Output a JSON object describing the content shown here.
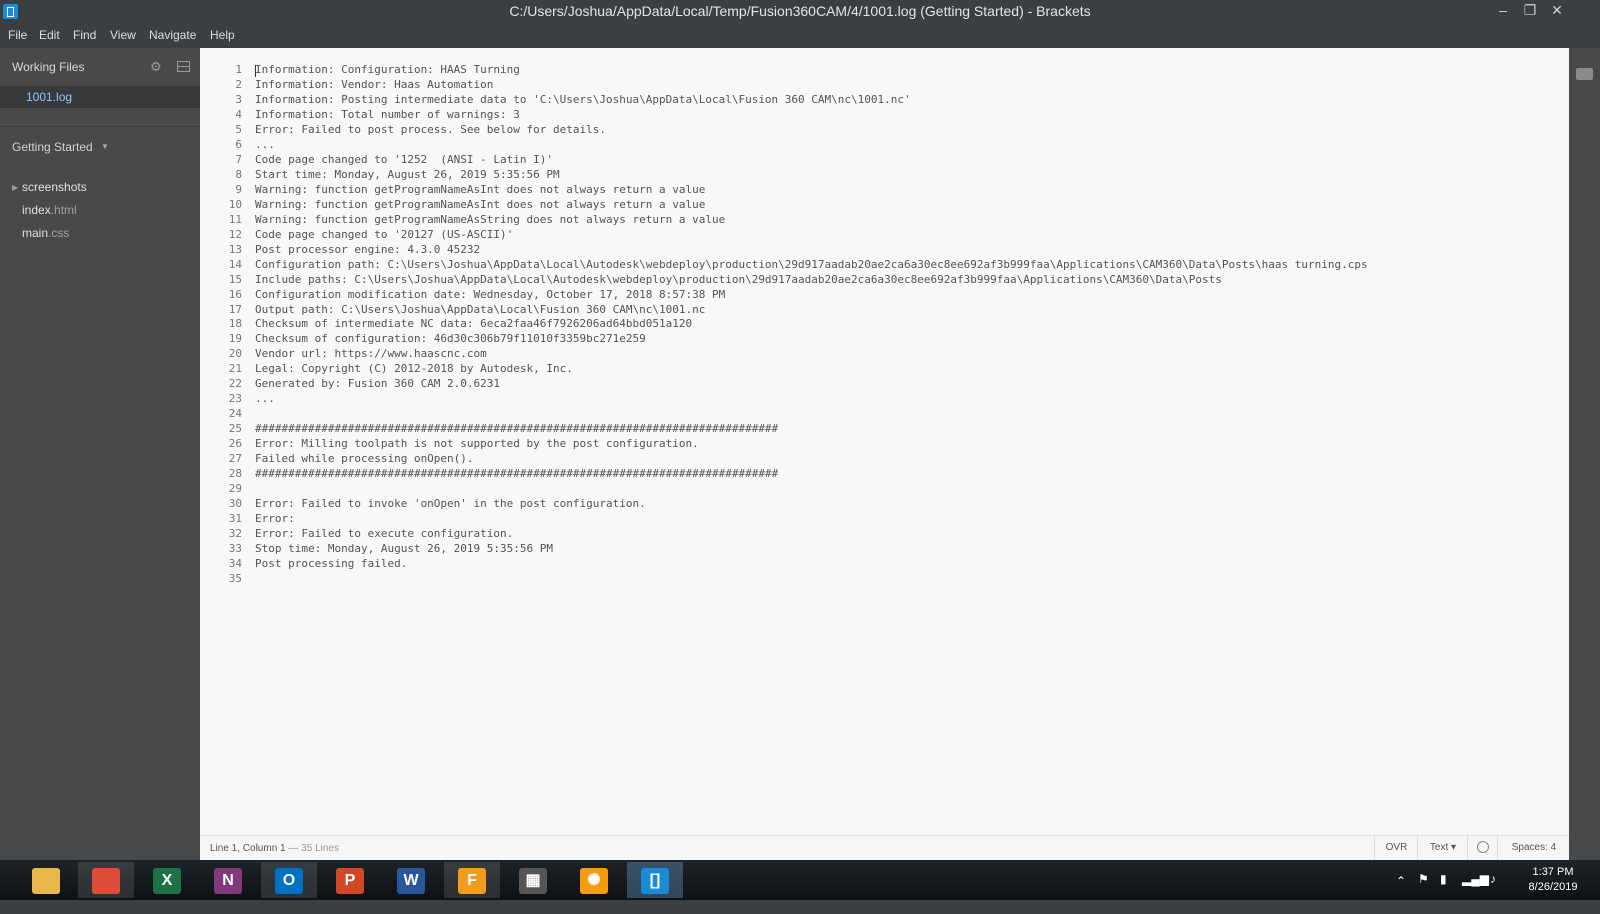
{
  "window": {
    "title": "C:/Users/Joshua/AppData/Local/Temp/Fusion360CAM/4/1001.log (Getting Started) - Brackets",
    "minimize_glyph": "–",
    "maximize_glyph": "❐",
    "close_glyph": "✕"
  },
  "menu": [
    "File",
    "Edit",
    "Find",
    "View",
    "Navigate",
    "Help"
  ],
  "sidebar": {
    "working_files_label": "Working Files",
    "working_files": [
      "1001.log"
    ],
    "project_title": "Getting Started",
    "tree": [
      {
        "name": "screenshots",
        "ext": ""
      },
      {
        "name": "index",
        "ext": ".html"
      },
      {
        "name": "main",
        "ext": ".css"
      }
    ]
  },
  "editor": {
    "lines": [
      "Information: Configuration: HAAS Turning",
      "Information: Vendor: Haas Automation",
      "Information: Posting intermediate data to 'C:\\Users\\Joshua\\AppData\\Local\\Fusion 360 CAM\\nc\\1001.nc'",
      "Information: Total number of warnings: 3",
      "Error: Failed to post process. See below for details.",
      "...",
      "Code page changed to '1252  (ANSI - Latin I)'",
      "Start time: Monday, August 26, 2019 5:35:56 PM",
      "Warning: function getProgramNameAsInt does not always return a value",
      "Warning: function getProgramNameAsInt does not always return a value",
      "Warning: function getProgramNameAsString does not always return a value",
      "Code page changed to '20127 (US-ASCII)'",
      "Post processor engine: 4.3.0 45232",
      "Configuration path: C:\\Users\\Joshua\\AppData\\Local\\Autodesk\\webdeploy\\production\\29d917aadab20ae2ca6a30ec8ee692af3b999faa\\Applications\\CAM360\\Data\\Posts\\haas turning.cps",
      "Include paths: C:\\Users\\Joshua\\AppData\\Local\\Autodesk\\webdeploy\\production\\29d917aadab20ae2ca6a30ec8ee692af3b999faa\\Applications\\CAM360\\Data\\Posts",
      "Configuration modification date: Wednesday, October 17, 2018 8:57:38 PM",
      "Output path: C:\\Users\\Joshua\\AppData\\Local\\Fusion 360 CAM\\nc\\1001.nc",
      "Checksum of intermediate NC data: 6eca2faa46f7926206ad64bbd051a120",
      "Checksum of configuration: 46d30c306b79f11010f3359bc271e259",
      "Vendor url: https://www.haascnc.com",
      "Legal: Copyright (C) 2012-2018 by Autodesk, Inc.",
      "Generated by: Fusion 360 CAM 2.0.6231",
      "...",
      "",
      "###############################################################################",
      "Error: Milling toolpath is not supported by the post configuration.",
      "Failed while processing onOpen().",
      "###############################################################################",
      "",
      "Error: Failed to invoke 'onOpen' in the post configuration.",
      "Error:",
      "Error: Failed to execute configuration.",
      "Stop time: Monday, August 26, 2019 5:35:56 PM",
      "Post processing failed.",
      ""
    ]
  },
  "status": {
    "position": "Line 1, Column 1",
    "lines_count": " — 35 Lines",
    "ovr": "OVR",
    "language": "Text ▾",
    "spaces": "Spaces: 4"
  },
  "taskbar": {
    "apps": [
      {
        "name": "file-explorer",
        "glyph": "",
        "color": "#e8b84a"
      },
      {
        "name": "chrome",
        "glyph": "",
        "color": "#dd4b39"
      },
      {
        "name": "excel",
        "glyph": "X",
        "color": "#1e7145"
      },
      {
        "name": "onenote",
        "glyph": "N",
        "color": "#80397b"
      },
      {
        "name": "outlook",
        "glyph": "O",
        "color": "#0072c6"
      },
      {
        "name": "powerpoint",
        "glyph": "P",
        "color": "#d24726"
      },
      {
        "name": "word",
        "glyph": "W",
        "color": "#2b579a"
      },
      {
        "name": "fusion360",
        "glyph": "F",
        "color": "#f29c1f"
      },
      {
        "name": "calculator",
        "glyph": "▦",
        "color": "#555555"
      },
      {
        "name": "settings-app",
        "glyph": "✺",
        "color": "#f39c12"
      },
      {
        "name": "brackets",
        "glyph": "[]",
        "color": "#1a8bd6"
      }
    ],
    "clock_time": "1:37 PM",
    "clock_date": "8/26/2019"
  },
  "colors": {
    "chrome": "#3c3f41",
    "sidebar": "#47494b",
    "editor_bg": "#f8f8f8",
    "selected_file": "#8fc6ff"
  }
}
